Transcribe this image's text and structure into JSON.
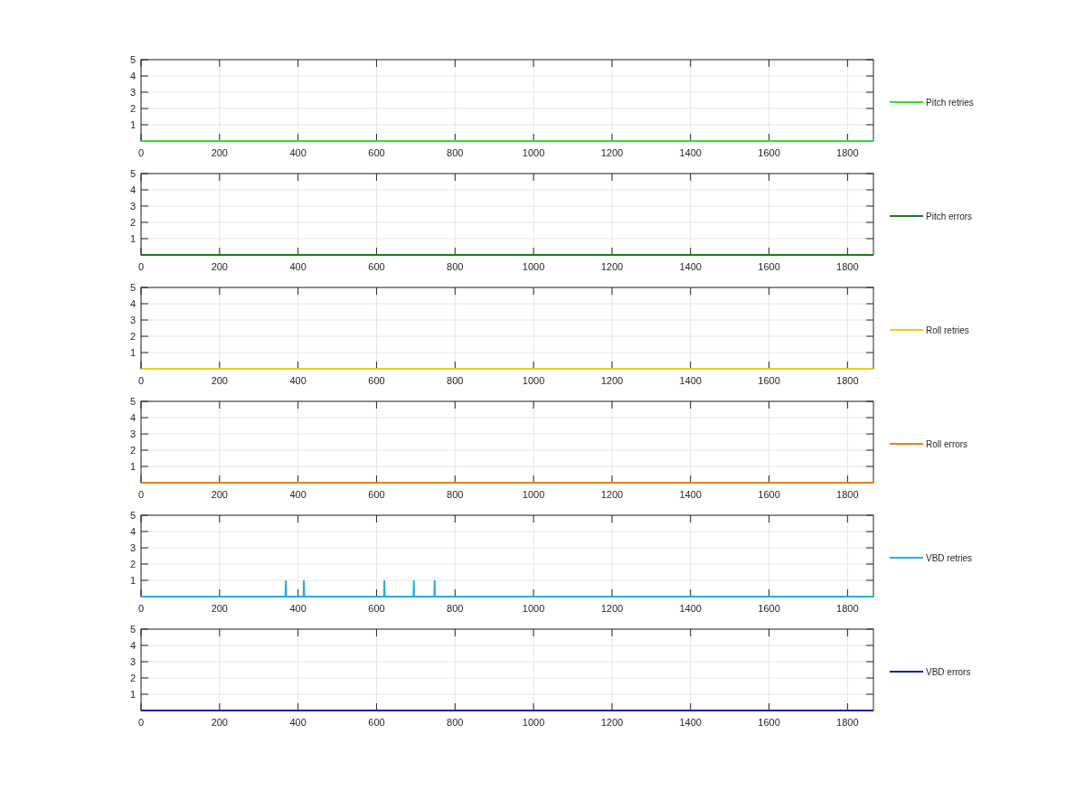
{
  "charts": [
    {
      "chart_data": {
        "type": "line",
        "x": [
          0,
          1866
        ],
        "series": [
          {
            "name": "Pitch retries",
            "color": "#2ee02e",
            "values": [
              0,
              0
            ]
          }
        ],
        "xlim": [
          0,
          1866
        ],
        "ylim": [
          0,
          5
        ],
        "xticks": [
          0,
          200,
          400,
          600,
          800,
          1000,
          1200,
          1400,
          1600,
          1800
        ],
        "yticks": [
          1,
          2,
          3,
          4,
          5
        ],
        "grid": true
      }
    },
    {
      "chart_data": {
        "type": "line",
        "x": [
          0,
          1866
        ],
        "series": [
          {
            "name": "Pitch errors",
            "color": "#1a7a1a",
            "values": [
              0,
              0
            ]
          }
        ],
        "xlim": [
          0,
          1866
        ],
        "ylim": [
          0,
          5
        ],
        "xticks": [
          0,
          200,
          400,
          600,
          800,
          1000,
          1200,
          1400,
          1600,
          1800
        ],
        "yticks": [
          1,
          2,
          3,
          4,
          5
        ],
        "grid": true
      }
    },
    {
      "chart_data": {
        "type": "line",
        "x": [
          0,
          1866
        ],
        "series": [
          {
            "name": "Roll retries",
            "color": "#f2cc10",
            "values": [
              0,
              0
            ]
          }
        ],
        "xlim": [
          0,
          1866
        ],
        "ylim": [
          0,
          5
        ],
        "xticks": [
          0,
          200,
          400,
          600,
          800,
          1000,
          1200,
          1400,
          1600,
          1800
        ],
        "yticks": [
          1,
          2,
          3,
          4,
          5
        ],
        "grid": true
      }
    },
    {
      "chart_data": {
        "type": "line",
        "x": [
          0,
          1866
        ],
        "series": [
          {
            "name": "Roll errors",
            "color": "#ee7d1a",
            "values": [
              0,
              0
            ]
          }
        ],
        "xlim": [
          0,
          1866
        ],
        "ylim": [
          0,
          5
        ],
        "xticks": [
          0,
          200,
          400,
          600,
          800,
          1000,
          1200,
          1400,
          1600,
          1800
        ],
        "yticks": [
          1,
          2,
          3,
          4,
          5
        ],
        "grid": true
      }
    },
    {
      "chart_data": {
        "type": "line",
        "x": [
          0,
          368,
          369,
          370,
          414,
          415,
          416,
          619,
          620,
          621,
          694,
          695,
          696,
          747,
          748,
          749,
          1866
        ],
        "series": [
          {
            "name": "VBD retries",
            "color": "#22b0e0",
            "values": [
              0,
              0,
              1,
              0,
              0,
              1,
              0,
              0,
              1,
              0,
              0,
              1,
              0,
              0,
              1,
              0,
              0
            ]
          }
        ],
        "xlim": [
          0,
          1866
        ],
        "ylim": [
          0,
          5
        ],
        "xticks": [
          0,
          200,
          400,
          600,
          800,
          1000,
          1200,
          1400,
          1600,
          1800
        ],
        "yticks": [
          1,
          2,
          3,
          4,
          5
        ],
        "grid": true
      }
    },
    {
      "chart_data": {
        "type": "line",
        "x": [
          0,
          1866
        ],
        "series": [
          {
            "name": "VBD errors",
            "color": "#0d1fb0",
            "values": [
              0,
              0
            ]
          }
        ],
        "xlim": [
          0,
          1866
        ],
        "ylim": [
          0,
          5
        ],
        "xticks": [
          0,
          200,
          400,
          600,
          800,
          1000,
          1200,
          1400,
          1600,
          1800
        ],
        "yticks": [
          1,
          2,
          3,
          4,
          5
        ],
        "grid": true
      }
    }
  ]
}
